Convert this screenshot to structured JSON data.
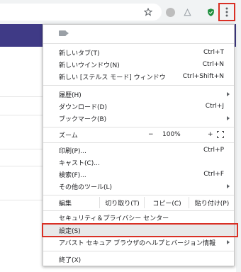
{
  "menu": {
    "new_tab": {
      "label": "新しいタブ(T)",
      "shortcut": "Ctrl+T"
    },
    "new_window": {
      "label": "新しいウインドウ(N)",
      "shortcut": "Ctrl+N"
    },
    "new_incognito": {
      "label": "新しい [ステルス モード] ウィンドウ",
      "shortcut": "Ctrl+Shift+N"
    },
    "history": {
      "label": "履歴(H)"
    },
    "downloads": {
      "label": "ダウンロード(D)",
      "shortcut": "Ctrl+J"
    },
    "bookmarks": {
      "label": "ブックマーク(B)"
    },
    "zoom": {
      "label": "ズーム",
      "minus": "−",
      "value": "100%",
      "plus": "+"
    },
    "print": {
      "label": "印刷(P)...",
      "shortcut": "Ctrl+P"
    },
    "cast": {
      "label": "キャスト(C)..."
    },
    "find": {
      "label": "検索(F)...",
      "shortcut": "Ctrl+F"
    },
    "more_tools": {
      "label": "その他のツール(L)"
    },
    "edit": {
      "label": "編集",
      "cut": "切り取り(T)",
      "copy": "コピー(C)",
      "paste": "貼り付け(P)"
    },
    "security": {
      "label": "セキュリティ＆プライバシー センター"
    },
    "settings": {
      "label": "設定(S)"
    },
    "help": {
      "label": "アバスト セキュア ブラウザのヘルプとバージョン情報"
    },
    "exit": {
      "label": "終了(X)"
    }
  }
}
